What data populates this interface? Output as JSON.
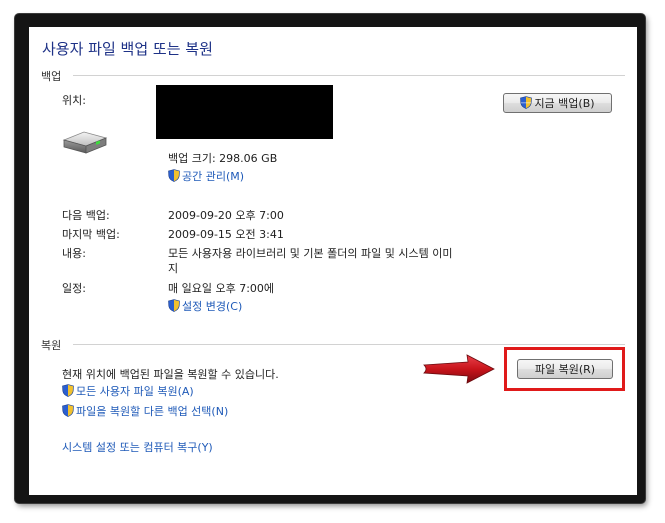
{
  "window": {
    "title": "사용자 파일 백업 또는 복원"
  },
  "backup": {
    "section_label": "백업",
    "location_label": "위치:",
    "backup_now_label": "지금 백업(B)",
    "size_text": "백업 크기: 298.06 GB",
    "manage_space_label": "공간 관리(M)",
    "next_backup_label": "다음 백업:",
    "next_backup_value": "2009-09-20 오후 7:00",
    "last_backup_label": "마지막 백업:",
    "last_backup_value": "2009-09-15 오전 3:41",
    "contents_label": "내용:",
    "contents_line1": "모든 사용자용 라이브러리 및 기본 폴더의 파일 및 시스템 이미",
    "contents_line2": "지",
    "schedule_label": "일정:",
    "schedule_value": "매 일요일 오후 7:00에",
    "change_settings_label": "설정 변경(C)"
  },
  "restore": {
    "section_label": "복원",
    "description": "현재 위치에 백업된 파일을 복원할 수 있습니다.",
    "restore_files_label": "파일 복원(R)",
    "restore_all_users_label": "모든 사용자 파일 복원(A)",
    "select_other_backup_label": "파일을 복원할 다른 백업 선택(N)",
    "recover_system_label": "시스템 설정 또는 컴퓨터 복구(Y)"
  },
  "colors": {
    "title": "#1e3287",
    "link": "#1f5ab8",
    "highlight_box": "#e01a1a",
    "arrow": "#c8141b"
  },
  "icons": [
    "hard-drive-icon",
    "shield-icon",
    "red-arrow-icon"
  ]
}
